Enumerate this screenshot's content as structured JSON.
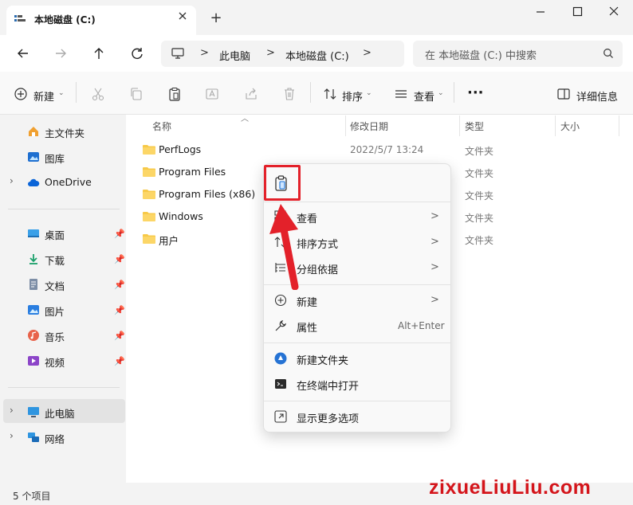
{
  "window": {
    "tab_title": "本地磁盘 (C:)",
    "new_tab_label": "+",
    "icons": [
      "drive-icon",
      "close-icon",
      "minimize-icon",
      "maximize-icon",
      "window-close-icon"
    ]
  },
  "nav": {
    "breadcrumb": [
      "此电脑",
      "本地磁盘 (C:)"
    ],
    "separator": ">",
    "search_placeholder": "在 本地磁盘 (C:) 中搜索"
  },
  "toolbar": {
    "new_label": "新建",
    "sort_label": "排序",
    "view_label": "查看",
    "more_label": "···",
    "details_label": "详细信息"
  },
  "sidebar": {
    "top_items": [
      {
        "label": "主文件夹",
        "icon": "home-icon"
      },
      {
        "label": "图库",
        "icon": "gallery-icon"
      },
      {
        "label": "OneDrive",
        "icon": "cloud-icon"
      }
    ],
    "quick_access": [
      {
        "label": "桌面",
        "icon": "desktop-icon"
      },
      {
        "label": "下载",
        "icon": "download-icon"
      },
      {
        "label": "文档",
        "icon": "document-icon"
      },
      {
        "label": "图片",
        "icon": "picture-icon"
      },
      {
        "label": "音乐",
        "icon": "music-icon"
      },
      {
        "label": "视频",
        "icon": "video-icon"
      }
    ],
    "bottom_items": [
      {
        "label": "此电脑",
        "icon": "computer-icon",
        "selected": true
      },
      {
        "label": "网络",
        "icon": "network-icon"
      }
    ]
  },
  "columns": {
    "name": "名称",
    "modified": "修改日期",
    "type": "类型",
    "size": "大小"
  },
  "files": [
    {
      "name": "PerfLogs",
      "modified": "2022/5/7 13:24",
      "type": "文件夹"
    },
    {
      "name": "Program Files",
      "modified": "",
      "type": "文件夹"
    },
    {
      "name": "Program Files (x86)",
      "modified": "",
      "type": "文件夹"
    },
    {
      "name": "Windows",
      "modified": "",
      "type": "文件夹"
    },
    {
      "name": "用户",
      "modified": "",
      "type": "文件夹"
    }
  ],
  "context_menu": {
    "paste_icon": "paste-icon",
    "items": [
      {
        "label": "查看",
        "icon": "view-icon",
        "submenu": true
      },
      {
        "label": "排序方式",
        "icon": "sort-icon",
        "submenu": true
      },
      {
        "label": "分组依据",
        "icon": "group-icon",
        "submenu": true
      },
      {
        "label": "新建",
        "icon": "new-icon",
        "submenu": true
      },
      {
        "label": "属性",
        "icon": "properties-icon",
        "shortcut": "Alt+Enter"
      },
      {
        "label": "新建文件夹",
        "icon": "new-folder-icon"
      },
      {
        "label": "在终端中打开",
        "icon": "terminal-icon"
      },
      {
        "label": "显示更多选项",
        "icon": "more-options-icon"
      }
    ],
    "submenu_arrow": ">"
  },
  "status": {
    "item_count": "5 个项目"
  },
  "watermark": {
    "text": "zixueLiuLiu.com"
  },
  "colors": {
    "accent": "#0067c0",
    "highlight": "#e3212a",
    "folder": "#f7c948"
  }
}
